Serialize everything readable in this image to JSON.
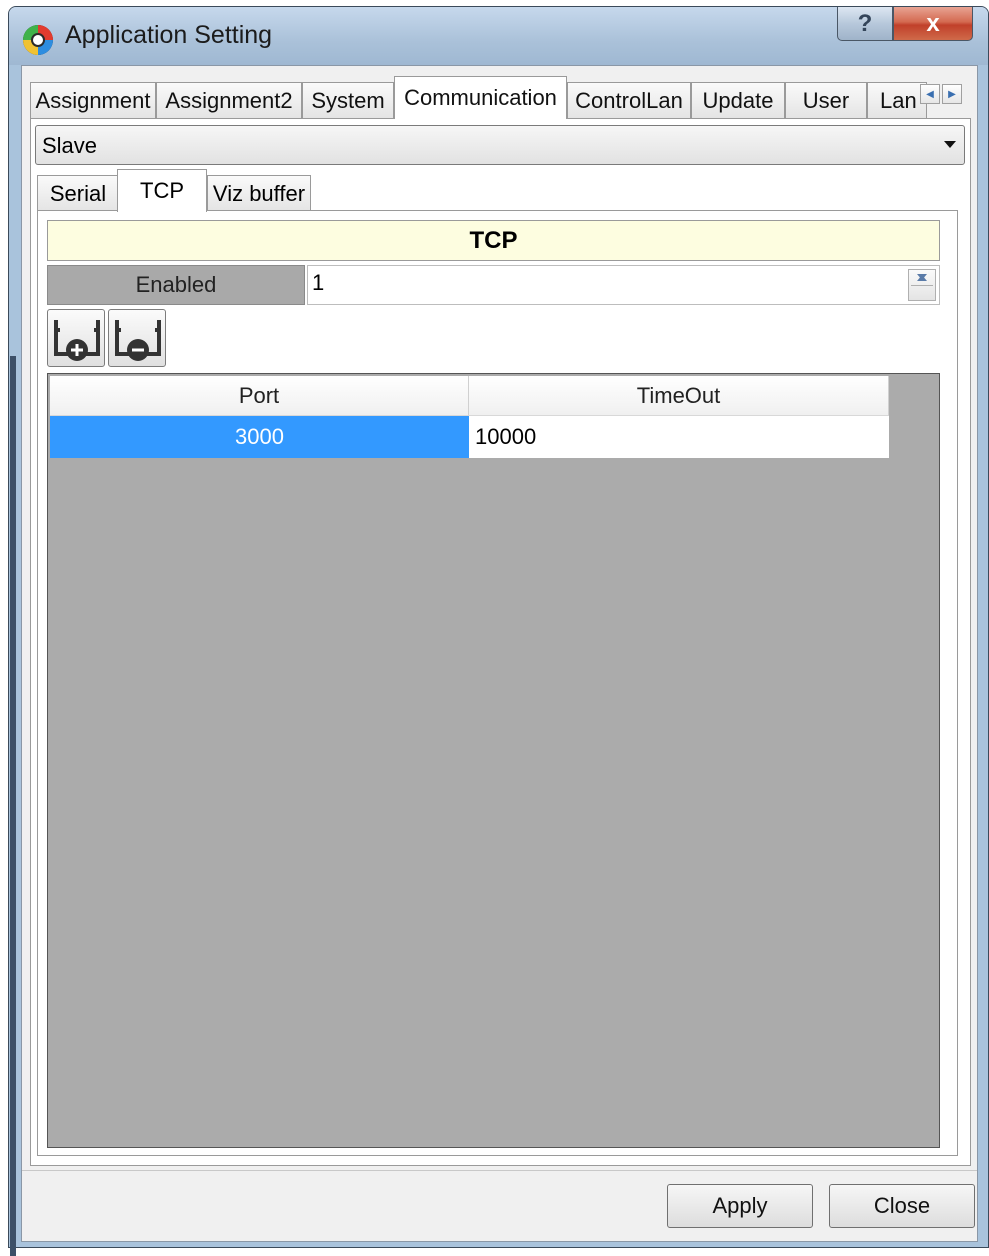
{
  "window": {
    "title": "Application Setting",
    "app_icon": "colorful-ring-icon",
    "help_glyph": "?",
    "close_glyph": "x"
  },
  "top_tabs": [
    {
      "label": "Assignment",
      "active": false
    },
    {
      "label": "Assignment2",
      "active": false
    },
    {
      "label": "System",
      "active": false
    },
    {
      "label": "Communication",
      "active": true
    },
    {
      "label": "ControlLan",
      "active": false
    },
    {
      "label": "Update",
      "active": false
    },
    {
      "label": "User",
      "active": false
    },
    {
      "label": "Lan",
      "active": false
    }
  ],
  "tab_scroll": {
    "left_icon": "arrow-left-icon",
    "right_icon": "arrow-right-icon"
  },
  "mode_combo": {
    "value": "Slave"
  },
  "inner_tabs": [
    {
      "label": "Serial",
      "active": false
    },
    {
      "label": "TCP",
      "active": true
    },
    {
      "label": "Viz buffer",
      "active": false
    }
  ],
  "tcp": {
    "header": "TCP",
    "enabled_label": "Enabled",
    "enabled_value": "1",
    "add_icon": "add-row-icon",
    "remove_icon": "remove-row-icon"
  },
  "grid": {
    "columns": [
      "Port",
      "TimeOut"
    ],
    "rows": [
      {
        "port": "3000",
        "timeout": "10000",
        "selected_cell": "port"
      }
    ]
  },
  "buttons": {
    "apply": "Apply",
    "close": "Close"
  },
  "colors": {
    "selection": "#3399ff",
    "header_bg": "#fdfde0",
    "grid_bg": "#ababab",
    "close_button": "#c1402a"
  }
}
